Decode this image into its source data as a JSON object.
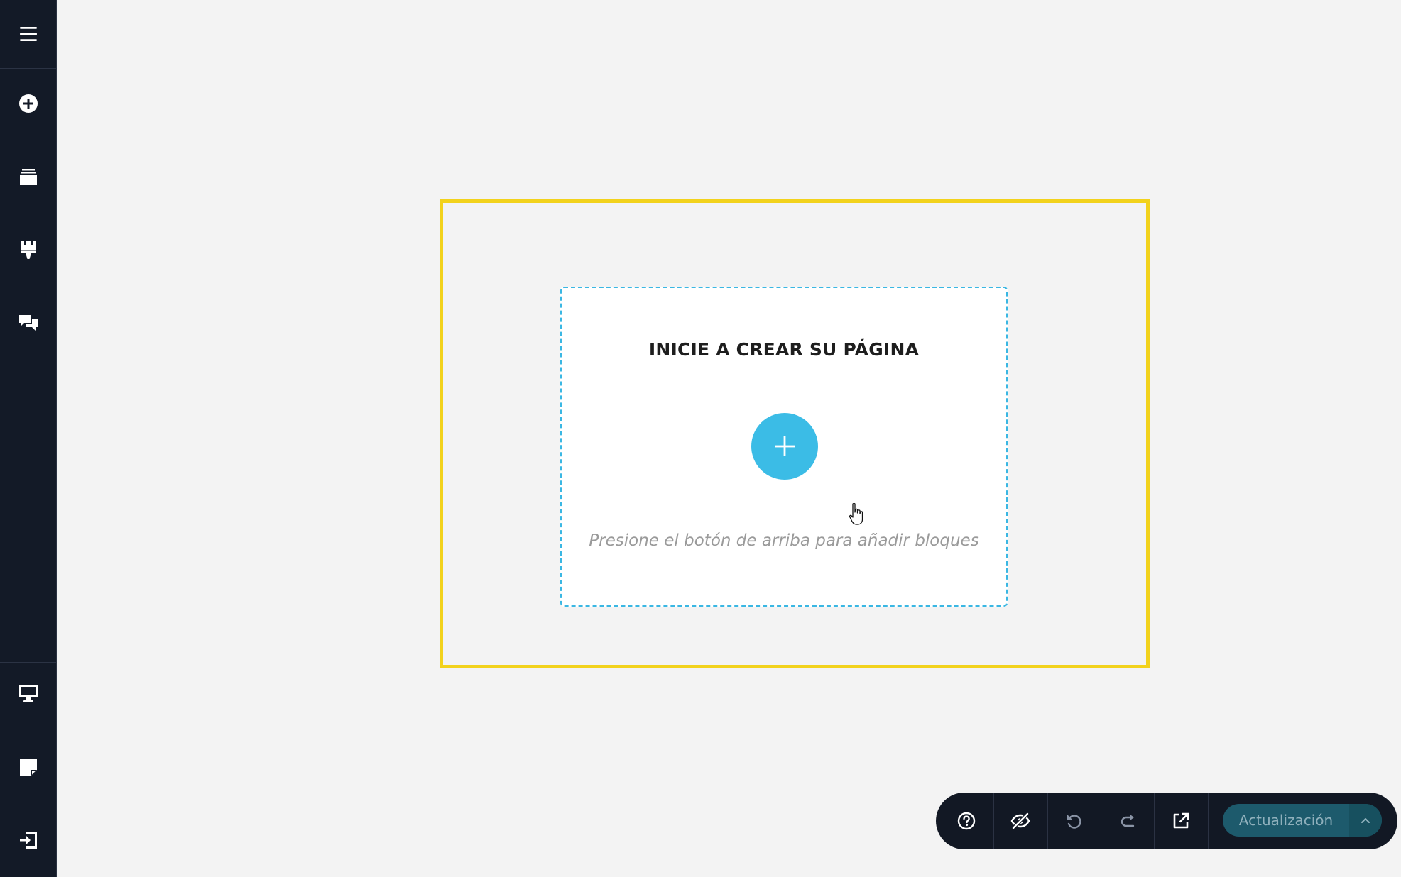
{
  "sidebar": {
    "items": [
      {
        "name": "menu",
        "icon": "hamburger-menu-icon"
      },
      {
        "name": "add",
        "icon": "plus-circle-icon"
      },
      {
        "name": "pages",
        "icon": "layers-icon"
      },
      {
        "name": "design",
        "icon": "paint-brush-icon"
      },
      {
        "name": "comments",
        "icon": "comments-icon"
      },
      {
        "name": "desktop-preview",
        "icon": "desktop-icon"
      },
      {
        "name": "notes",
        "icon": "sticky-note-icon"
      },
      {
        "name": "exit",
        "icon": "exit-icon"
      }
    ]
  },
  "canvas": {
    "title": "INICIE A CREAR SU PÁGINA",
    "hint": "Presione el botón de arriba para añadir bloques",
    "add_icon": "plus-icon"
  },
  "toolbar": {
    "buttons": [
      {
        "name": "help",
        "icon": "question-circle-icon"
      },
      {
        "name": "hide-preview",
        "icon": "eye-slash-icon"
      },
      {
        "name": "undo",
        "icon": "undo-icon"
      },
      {
        "name": "redo",
        "icon": "redo-icon"
      },
      {
        "name": "open-external",
        "icon": "external-link-icon"
      }
    ],
    "update_label": "Actualización",
    "update_menu_icon": "chevron-up-icon"
  },
  "colors": {
    "sidebar_bg": "#131a27",
    "canvas_bg": "#f3f3f3",
    "frame_border": "#f2d21c",
    "accent": "#3bbce6",
    "toolbar_bg": "#121824",
    "update_button_bg": "#1d5a6c"
  }
}
